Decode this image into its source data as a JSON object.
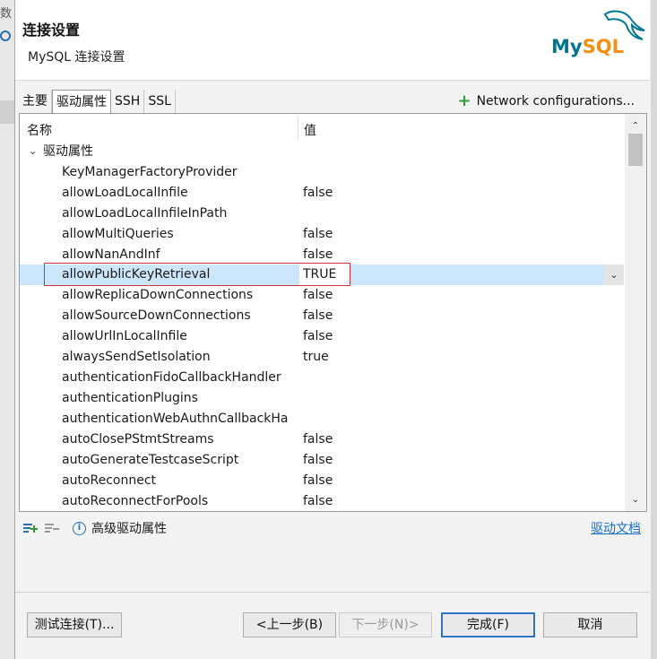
{
  "background": {
    "peek_text": "数"
  },
  "header": {
    "title": "连接设置",
    "subtitle": "MySQL 连接设置",
    "logo_text_my": "My",
    "logo_text_sql": "SQL"
  },
  "tabs": [
    {
      "label": "主要",
      "active": false
    },
    {
      "label": "驱动属性",
      "active": true
    },
    {
      "label": "SSH",
      "active": false
    },
    {
      "label": "SSL",
      "active": false
    }
  ],
  "network_configurations": {
    "label": "Network configurations..."
  },
  "table": {
    "col_name": "名称",
    "col_value": "值",
    "group_label": "驱动属性",
    "rows": [
      {
        "name": "KeyManagerFactoryProvider",
        "value": ""
      },
      {
        "name": "allowLoadLocalInfile",
        "value": "false"
      },
      {
        "name": "allowLoadLocalInfileInPath",
        "value": ""
      },
      {
        "name": "allowMultiQueries",
        "value": "false"
      },
      {
        "name": "allowNanAndInf",
        "value": "false"
      },
      {
        "name": "allowPublicKeyRetrieval",
        "value": "TRUE"
      },
      {
        "name": "allowReplicaDownConnections",
        "value": "false"
      },
      {
        "name": "allowSourceDownConnections",
        "value": "false"
      },
      {
        "name": "allowUrlInLocalInfile",
        "value": "false"
      },
      {
        "name": "alwaysSendSetIsolation",
        "value": "true"
      },
      {
        "name": "authenticationFidoCallbackHandler",
        "value": ""
      },
      {
        "name": "authenticationPlugins",
        "value": ""
      },
      {
        "name": "authenticationWebAuthnCallbackHa",
        "value": ""
      },
      {
        "name": "autoClosePStmtStreams",
        "value": "false"
      },
      {
        "name": "autoGenerateTestcaseScript",
        "value": "false"
      },
      {
        "name": "autoReconnect",
        "value": "false"
      },
      {
        "name": "autoReconnectForPools",
        "value": "false"
      }
    ]
  },
  "toolbar": {
    "advanced_label": "高级驱动属性",
    "docs_link": "驱动文档"
  },
  "buttons": {
    "test": "测试连接(T)...",
    "back": "<上一步(B)",
    "next": "下一步(N)>",
    "finish": "完成(F)",
    "cancel": "取消"
  },
  "colors": {
    "accent": "#2f74c9",
    "selection": "#cce6fb",
    "highlight_box": "#d9333a",
    "add_green": "#2e9e3a",
    "mysql_blue": "#00758f",
    "mysql_orange": "#f29111"
  }
}
